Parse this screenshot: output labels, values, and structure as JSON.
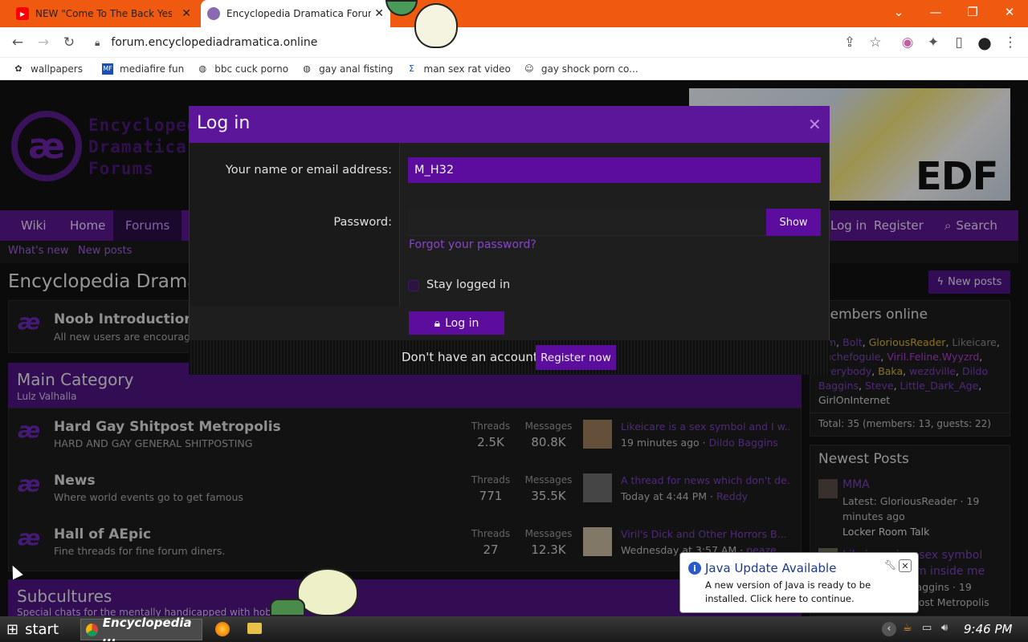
{
  "browser": {
    "tabs": [
      {
        "title": "NEW \"Come To The Back Yes\"",
        "close": "✕"
      },
      {
        "title": "Encyclopedia Dramatica Forum",
        "close": "✕"
      }
    ],
    "window_controls": {
      "min": "—",
      "max": "❐",
      "close": "✕",
      "dropdown": "⌄"
    },
    "url": "forum.encyclopediadramatica.online",
    "bookmarks": [
      {
        "label": "wallpapers"
      },
      {
        "label": "mediafire fun"
      },
      {
        "label": "bbc cuck porno"
      },
      {
        "label": "gay anal fisting"
      },
      {
        "label": "man sex rat video"
      },
      {
        "label": "gay shock porn co..."
      }
    ]
  },
  "forum": {
    "logo_lines": [
      "Encyclopedia",
      "Dramatica",
      "Forums"
    ],
    "logo_glyph": "æ",
    "banner_text": "EDF",
    "nav": {
      "wiki": "Wiki",
      "home": "Home",
      "forums": "Forums",
      "login": "Log in",
      "register": "Register",
      "search": "Search"
    },
    "subnav": {
      "whats_new": "What's new",
      "new_posts": "New posts"
    },
    "page_title": "Encyclopedia Dramatica Forums",
    "new_posts_button": "New posts",
    "noob_intro": {
      "title": "Noob Introduction",
      "desc": "All new users are encouraged to introduce themselves here."
    },
    "main_category": {
      "title": "Main Category",
      "subtitle": "Lulz Valhalla"
    },
    "nodes": [
      {
        "title": "Hard Gay Shitpost Metropolis",
        "desc": "HARD AND GAY GENERAL SHITPOSTING",
        "threads_label": "Threads",
        "threads": "2.5K",
        "messages_label": "Messages",
        "messages": "80.8K",
        "last_title": "Likeicare is a sex symbol and I w...",
        "last_time": "19 minutes ago",
        "last_user": "Dildo Baggins"
      },
      {
        "title": "News",
        "desc": "Where world events go to get famous",
        "threads_label": "Threads",
        "threads": "771",
        "messages_label": "Messages",
        "messages": "35.5K",
        "last_title": "A thread for news which don't de...",
        "last_time": "Today at 4:44 PM",
        "last_user": "Reddy"
      },
      {
        "title": "Hall of AEpic",
        "desc": "Fine threads for fine forum diners.",
        "threads_label": "Threads",
        "threads": "27",
        "messages_label": "Messages",
        "messages": "12.3K",
        "last_title": "Viril's Dick and Other Horrors B...",
        "last_time": "Wednesday at 3:57 AM",
        "last_user": "peaze"
      }
    ],
    "subcultures": {
      "title": "Subcultures",
      "desc": "Special chats for the mentally handicapped with hobbies"
    },
    "members_online": {
      "title": "Members online",
      "line1": [
        "ism",
        "Bolt",
        "GloriousReader",
        "Likeicare"
      ],
      "line2": [
        "duchefogule",
        "Viril.Feline.Wyyzrd"
      ],
      "line3": [
        "everybody",
        "Baka",
        "wezdville",
        "Dildo"
      ],
      "line4": [
        "Baggins",
        "Steve",
        "Little_Dark_Age"
      ],
      "line5": [
        "GirlOnInternet"
      ],
      "total": "Total: 35 (members: 13, guests: 22)"
    },
    "newest_posts": {
      "title": "Newest Posts",
      "items": [
        {
          "title": "MMA",
          "meta": "Latest: GloriousReader · 19",
          "meta2": "minutes ago",
          "forum": "Locker Room Talk"
        },
        {
          "title": "Likeicare is a sex symbol",
          "title2": "and I want him inside me",
          "meta": "Latest: Dildo Baggins · 19",
          "forum": "Hard Gay Shitpost Metropolis"
        }
      ]
    }
  },
  "login_modal": {
    "title": "Log in",
    "close": "✕",
    "username_label": "Your name or email address:",
    "username_value": "M_H32",
    "password_label": "Password:",
    "show_button": "Show",
    "forgot": "Forgot your password?",
    "stay_logged_in": "Stay logged in",
    "login_button": "Log in",
    "no_account": "Don't have an account?",
    "register_button": "Register now"
  },
  "java_popup": {
    "title": "Java Update Available",
    "body": "A new version of Java is ready to be installed. Click here to continue.",
    "close": "✕"
  },
  "taskbar": {
    "start": "start",
    "chrome_task": "Encyclopedia ...",
    "clock": "9:46 PM"
  },
  "colors": {
    "accent": "#5c0d9e",
    "nav": "#58168c",
    "tabbar": "#f05a10",
    "link": "#7a3fb8",
    "gold_user": "#d4b030"
  }
}
